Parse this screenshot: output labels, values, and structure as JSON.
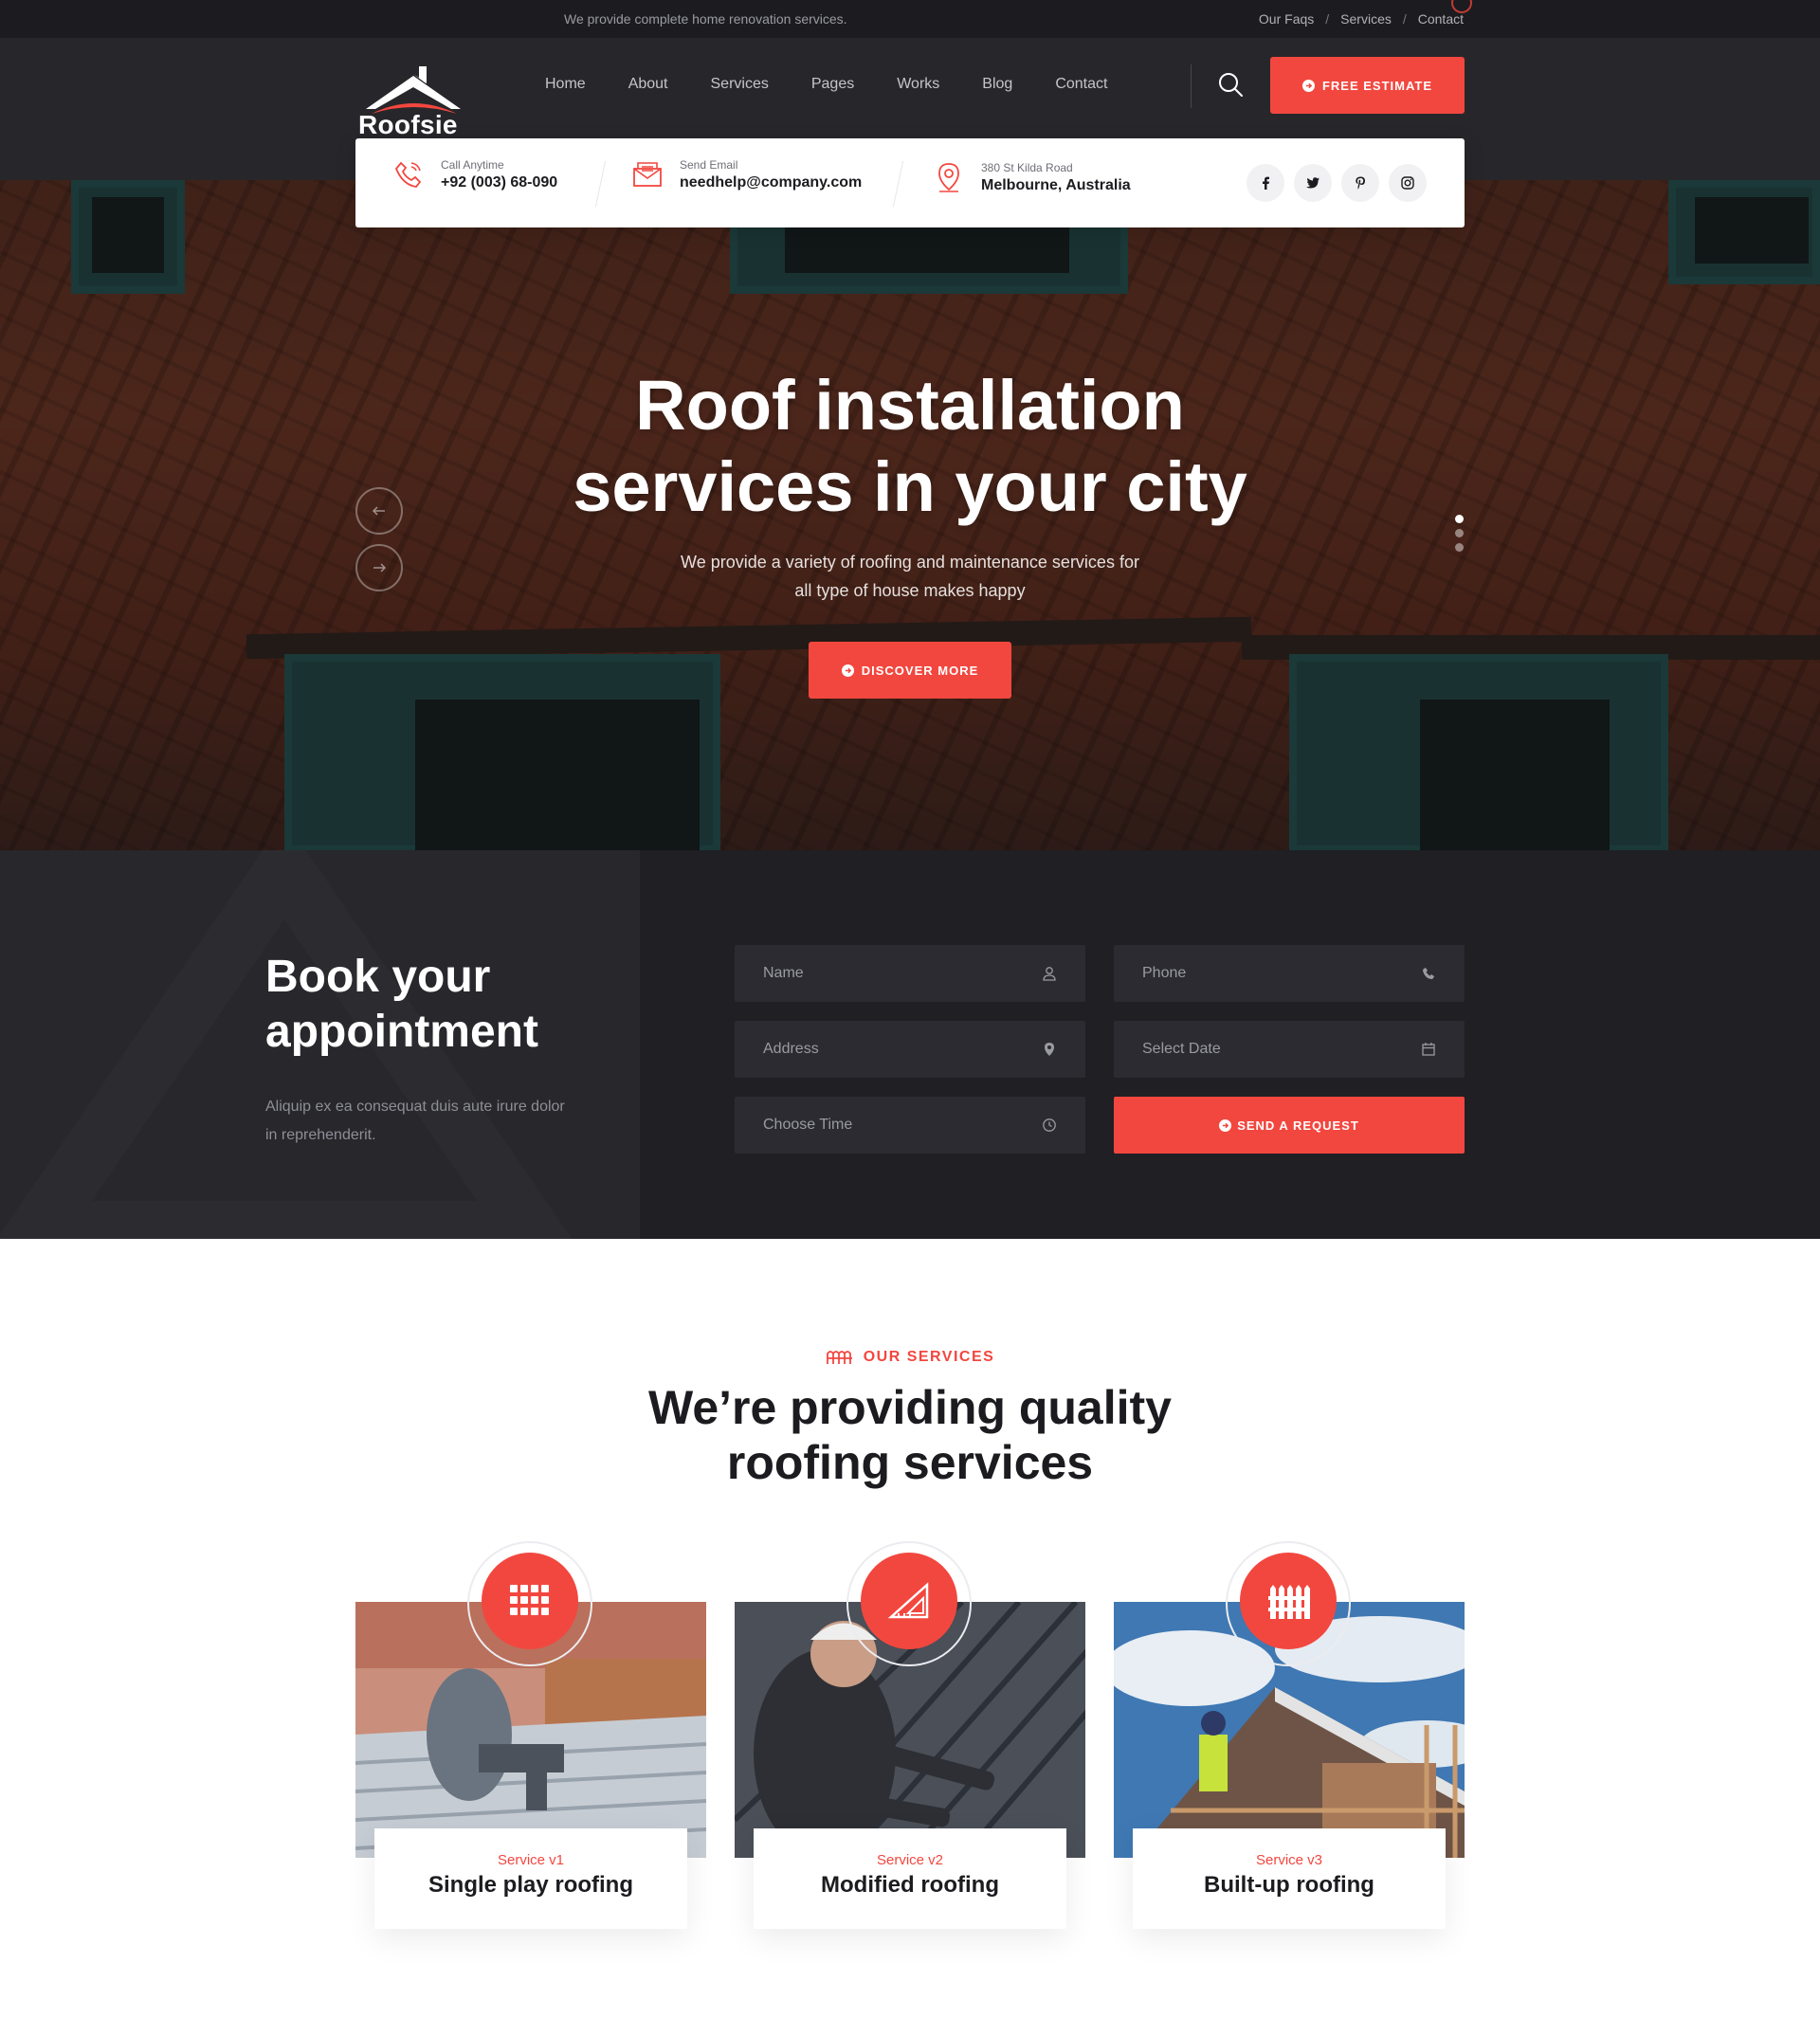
{
  "topbar": {
    "tagline": "We provide complete home renovation services.",
    "links": [
      "Our Faqs",
      "Services",
      "Contact"
    ],
    "separator": "/"
  },
  "header": {
    "logo_text": "Roofsie",
    "nav": [
      "Home",
      "About",
      "Services",
      "Pages",
      "Works",
      "Blog",
      "Contact"
    ],
    "estimate_label": "FREE ESTIMATE"
  },
  "contact": {
    "phone_label": "Call Anytime",
    "phone": "+92 (003) 68-090",
    "email_label": "Send Email",
    "email": "needhelp@company.com",
    "address_label": "380 St Kilda Road",
    "address": "Melbourne, Australia",
    "socials": [
      "facebook-icon",
      "twitter-icon",
      "pinterest-icon",
      "instagram-icon"
    ]
  },
  "hero": {
    "title_line1": "Roof installation",
    "title_line2": "services in your city",
    "subtitle_line1": "We provide a variety of roofing and maintenance services for",
    "subtitle_line2": "all type of house makes happy",
    "button": "DISCOVER MORE",
    "slides": 3,
    "active_slide": 1
  },
  "appointment": {
    "title_line1": "Book your",
    "title_line2": "appointment",
    "subtitle": "Aliquip ex ea consequat duis aute irure dolor in reprehenderit.",
    "fields": {
      "name": "Name",
      "phone": "Phone",
      "address": "Address",
      "date": "Select Date",
      "time": "Choose Time"
    },
    "submit": "SEND A REQUEST"
  },
  "services": {
    "tag": "OUR SERVICES",
    "title_line1": "We’re providing quality",
    "title_line2": "roofing services",
    "items": [
      {
        "tag": "Service v1",
        "title": "Single play roofing",
        "icon": "tiles-icon"
      },
      {
        "tag": "Service v2",
        "title": "Modified roofing",
        "icon": "set-square-icon"
      },
      {
        "tag": "Service v3",
        "title": "Built-up roofing",
        "icon": "fence-icon"
      }
    ]
  },
  "colors": {
    "accent": "#f2473f",
    "dark": "#1f1f24",
    "header": "#27272b"
  }
}
